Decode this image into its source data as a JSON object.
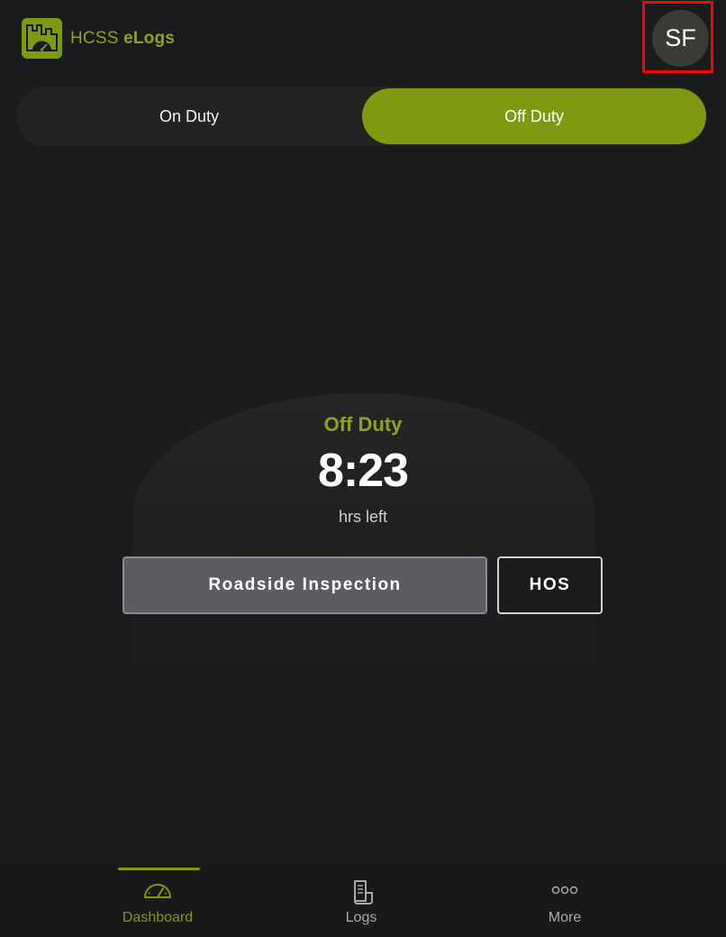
{
  "header": {
    "brand_regular": "HCSS",
    "brand_bold": "eLogs",
    "avatar_initials": "SF"
  },
  "duty_toggle": {
    "on_label": "On Duty",
    "off_label": "Off Duty",
    "selected": "Off Duty"
  },
  "status": {
    "label": "Off Duty",
    "time_left": "8:23",
    "units": "hrs left"
  },
  "actions": {
    "roadside_label": "Roadside Inspection",
    "hos_label": "HOS"
  },
  "bottom_nav": {
    "items": [
      {
        "label": "Dashboard",
        "icon": "speedometer-icon",
        "active": true
      },
      {
        "label": "Logs",
        "icon": "document-icon",
        "active": false
      },
      {
        "label": "More",
        "icon": "more-dots-icon",
        "active": false
      }
    ]
  },
  "colors": {
    "accent": "#7d9a10",
    "background": "#1b1a1c",
    "highlight_frame": "#ff0000"
  }
}
